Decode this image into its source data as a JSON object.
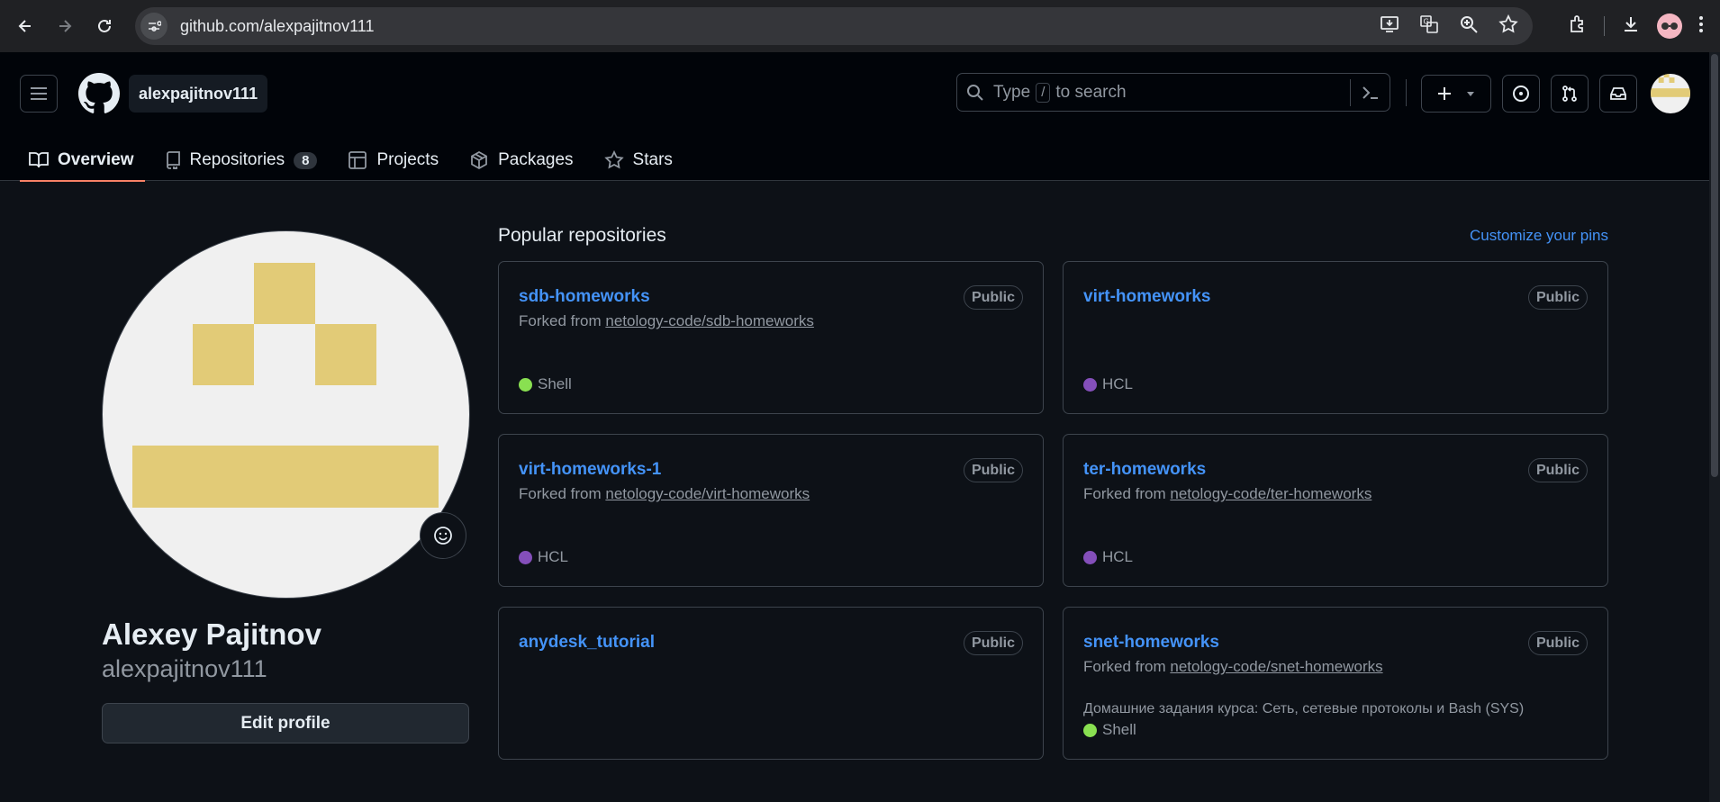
{
  "browser": {
    "url": "github.com/alexpajitnov111"
  },
  "header": {
    "context_label": "alexpajitnov111",
    "search": {
      "prefix": "Type",
      "key": "/",
      "suffix": "to search"
    }
  },
  "tabs": [
    {
      "label": "Overview",
      "icon": "book-icon",
      "active": true
    },
    {
      "label": "Repositories",
      "icon": "repo-icon",
      "count": "8"
    },
    {
      "label": "Projects",
      "icon": "table-icon"
    },
    {
      "label": "Packages",
      "icon": "package-icon"
    },
    {
      "label": "Stars",
      "icon": "star-icon"
    }
  ],
  "profile": {
    "name": "Alexey Pajitnov",
    "login": "alexpajitnov111",
    "edit_label": "Edit profile",
    "avatar_color": "#e2cb77"
  },
  "popular": {
    "title": "Popular repositories",
    "customize_label": "Customize your pins",
    "repos": [
      {
        "name": "sdb-homeworks",
        "visibility": "Public",
        "fork_prefix": "Forked from",
        "fork_source": "netology-code/sdb-homeworks",
        "description": "",
        "language": "Shell",
        "lang_color": "#89e051"
      },
      {
        "name": "virt-homeworks",
        "visibility": "Public",
        "fork_prefix": "",
        "fork_source": "",
        "description": "",
        "language": "HCL",
        "lang_color": "#844FBA"
      },
      {
        "name": "virt-homeworks-1",
        "visibility": "Public",
        "fork_prefix": "Forked from",
        "fork_source": "netology-code/virt-homeworks",
        "description": "",
        "language": "HCL",
        "lang_color": "#844FBA"
      },
      {
        "name": "ter-homeworks",
        "visibility": "Public",
        "fork_prefix": "Forked from",
        "fork_source": "netology-code/ter-homeworks",
        "description": "",
        "language": "HCL",
        "lang_color": "#844FBA"
      },
      {
        "name": "anydesk_tutorial",
        "visibility": "Public",
        "fork_prefix": "",
        "fork_source": "",
        "description": "",
        "language": "",
        "lang_color": ""
      },
      {
        "name": "snet-homeworks",
        "visibility": "Public",
        "fork_prefix": "Forked from",
        "fork_source": "netology-code/snet-homeworks",
        "description": "Домашние задания курса: Сеть, сетевые протоколы и Bash (SYS)",
        "language": "Shell",
        "lang_color": "#89e051"
      }
    ]
  },
  "colors": {
    "accent_link": "#4493f8",
    "tab_underline": "#f78166",
    "background": "#0d1117"
  }
}
